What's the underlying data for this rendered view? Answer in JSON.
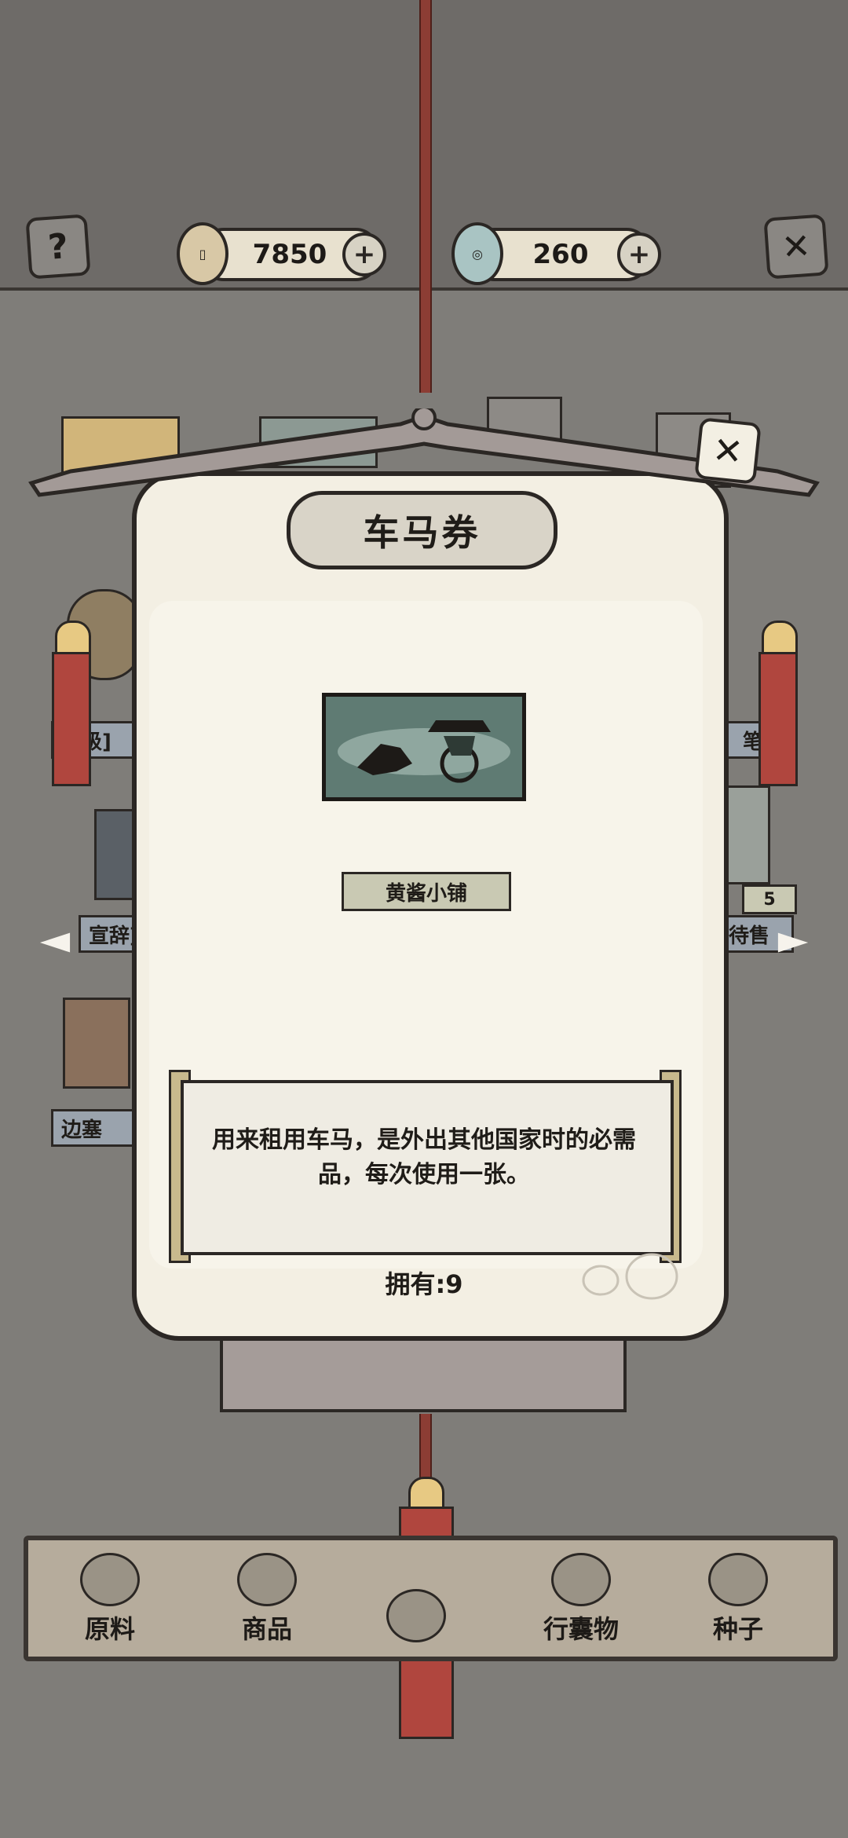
{
  "topbar": {
    "help_icon": "question-icon",
    "coins": "7850",
    "gems": "260",
    "close_icon": "close-icon"
  },
  "background": {
    "shelf_labels": [
      "超级]",
      "笔记",
      "宣辞]",
      "待售",
      "边塞"
    ],
    "badge": "5"
  },
  "dialog": {
    "title": "车马券",
    "shop_label": "黄酱小铺",
    "description_line1": "用来租用车马，是外出其他国家时的必需",
    "description_line2": "品，每次使用一张。",
    "owned": "拥有:9"
  },
  "bottom_nav": {
    "items": [
      {
        "label": "原料",
        "icon": "leaf-icon"
      },
      {
        "label": "商品",
        "icon": "goods-icon"
      },
      {
        "label": "",
        "icon": "scroll-icon"
      },
      {
        "label": "行囊物",
        "icon": "clothes-icon"
      },
      {
        "label": "种子",
        "icon": "jar-icon"
      }
    ]
  },
  "colors": {
    "background": "#7f7d79",
    "panel": "#f3efe3",
    "tassel": "#b0463e",
    "rope": "#8c3d34"
  }
}
